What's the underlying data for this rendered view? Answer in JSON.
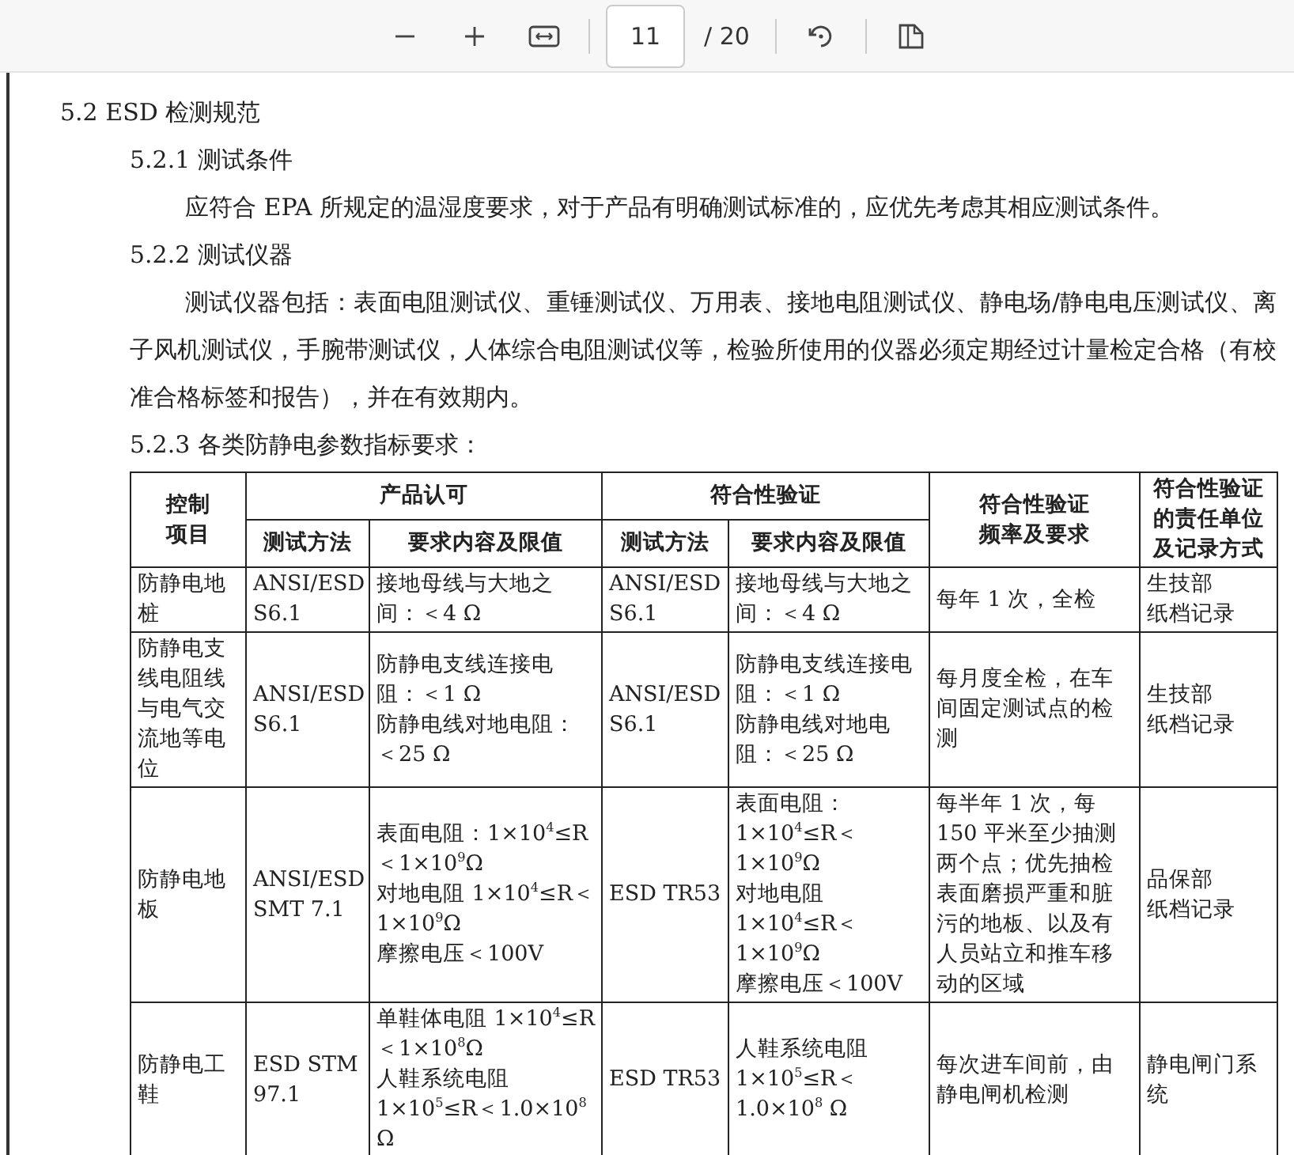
{
  "toolbar": {
    "page_input": "11",
    "page_total": "/ 20"
  },
  "document": {
    "heading": "5.2 ESD 检测规范",
    "sections": [
      {
        "title": "5.2.1 测试条件",
        "paragraph": "应符合 EPA 所规定的温湿度要求，对于产品有明确测试标准的，应优先考虑其相应测试条件。"
      },
      {
        "title": "5.2.2 测试仪器",
        "paragraph": "测试仪器包括：表面电阻测试仪、重锤测试仪、万用表、接地电阻测试仪、静电场/静电电压测试仪、离子风机测试仪，手腕带测试仪，人体综合电阻测试仪等，检验所使用的仪器必须定期经过计量检定合格（有校准合格标签和报告），并在有效期内。"
      },
      {
        "title": "5.2.3 各类防静电参数指标要求："
      }
    ],
    "table": {
      "header_top": [
        {
          "label": "控制项目",
          "kind": "rowspan"
        },
        {
          "label": "产品认可",
          "kind": "colspan"
        },
        {
          "label": "符合性验证",
          "kind": "colspan"
        },
        {
          "label": "符合性验证频率及要求",
          "kind": "rowspan"
        },
        {
          "label": "符合性验证的责任单位及记录方式",
          "kind": "rowspan"
        }
      ],
      "header_sub": [
        "测试方法",
        "要求内容及限值",
        "测试方法",
        "要求内容及限值"
      ],
      "rows": [
        [
          "防静电地桩",
          "ANSI/ESD S6.1",
          "接地母线与大地之间：＜4 Ω",
          "ANSI/ESD S6.1",
          "接地母线与大地之间：＜4 Ω",
          "每年 1 次，全检",
          [
            "生技部",
            "纸档记录"
          ]
        ],
        [
          "防静电支线电阻线与电气交流地等电位",
          "ANSI/ESD S6.1",
          "防静电支线连接电阻：＜1 Ω\n防静电线对地电阻：＜25 Ω",
          "ANSI/ESD S6.1",
          "防静电支线连接电阻：＜1 Ω\n防静电线对地电阻：＜25 Ω",
          "每月度全检，在车间固定测试点的检测",
          [
            "生技部",
            "纸档记录"
          ]
        ],
        [
          "防静电地板",
          "ANSI/ESD SMT 7.1",
          "表面电阻：1×10$^{4}$≤R＜1×10$^{9}$Ω\n对地电阻 1×10$^{4}$≤R＜1×10$^{9}$Ω\n摩擦电压＜100V",
          "ESD TR53",
          "表面电阻：1×10$^{4}$≤R＜1×10$^{9}$Ω\n对地电阻 1×10$^{4}$≤R＜1×10$^{9}$Ω\n摩擦电压＜100V",
          "每半年 1 次，每 150 平米至少抽测两个点；优先抽检表面磨损严重和脏污的地板、以及有人员站立和推车移动的区域",
          [
            "品保部",
            "纸档记录"
          ]
        ],
        [
          "防静电工鞋",
          "ESD STM 97.1",
          "单鞋体电阻 1×10$^{4}$≤R＜1×10$^{8}$Ω\n人鞋系统电阻 1×10$^{5}$≤R＜1.0×10$^{8}$ Ω",
          "ESD TR53",
          "人鞋系统电阻 1×10$^{5}$≤R＜1.0×10$^{8}$ Ω",
          "每次进车间前，由静电闸机检测",
          "静电闸门系统"
        ]
      ]
    }
  }
}
